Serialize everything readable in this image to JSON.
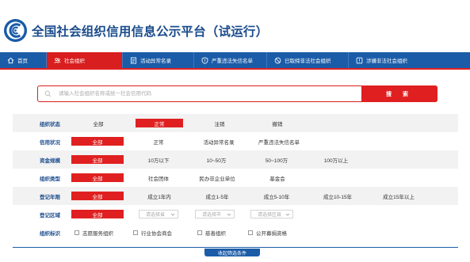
{
  "site": {
    "title": "全国社会组织信用信息公示平台（试运行）"
  },
  "nav": {
    "items": [
      {
        "label": "首页",
        "icon": "home-icon"
      },
      {
        "label": "社会组织",
        "icon": "users-icon",
        "active": true
      },
      {
        "label": "活动异常名录",
        "icon": "list-icon"
      },
      {
        "label": "严重违法失信名单",
        "icon": "shield-icon"
      },
      {
        "label": "已取缔非法社会组织",
        "icon": "ban-icon"
      },
      {
        "label": "涉嫌非法社会组织",
        "icon": "warning-icon"
      }
    ]
  },
  "search": {
    "placeholder": "请输入社会组织名称或统一社会信用代码",
    "button": "搜 索"
  },
  "filters": {
    "org_status": {
      "label": "组织状态",
      "options": [
        "全部",
        "正常",
        "注销",
        "撤销"
      ],
      "selected": "正常"
    },
    "credit_status": {
      "label": "信用状况",
      "options": [
        "全部",
        "正常",
        "活动异常名录",
        "严重违法失信名单"
      ],
      "selected": "全部"
    },
    "capital_scale": {
      "label": "资金规模",
      "options": [
        "全部",
        "10万以下",
        "10~50万",
        "50~100万",
        "100万以上"
      ],
      "selected": "全部"
    },
    "org_type": {
      "label": "组织类型",
      "options": [
        "全部",
        "社会团体",
        "民办非企业单位",
        "基金会"
      ],
      "selected": "全部"
    },
    "reg_period": {
      "label": "登记年限",
      "options": [
        "全部",
        "成立1年内",
        "成立1-5年",
        "成立5-10年",
        "成立10-15年",
        "成立15年以上"
      ],
      "selected": "全部"
    },
    "reg_region": {
      "label": "登记区域",
      "all": "全部",
      "province": "请选择省",
      "city": "请选择市",
      "district": "请选择区县"
    },
    "org_tags": {
      "label": "组织标识",
      "options": [
        "志愿服务组织",
        "行业协会商会",
        "慈善组织",
        "公开募捐资格"
      ]
    }
  },
  "collapse": {
    "label": "收起筛选条件"
  },
  "colors": {
    "brand_blue": "#1a5ca8",
    "accent_red": "#e02020",
    "title_blue": "#1a4b8c"
  }
}
